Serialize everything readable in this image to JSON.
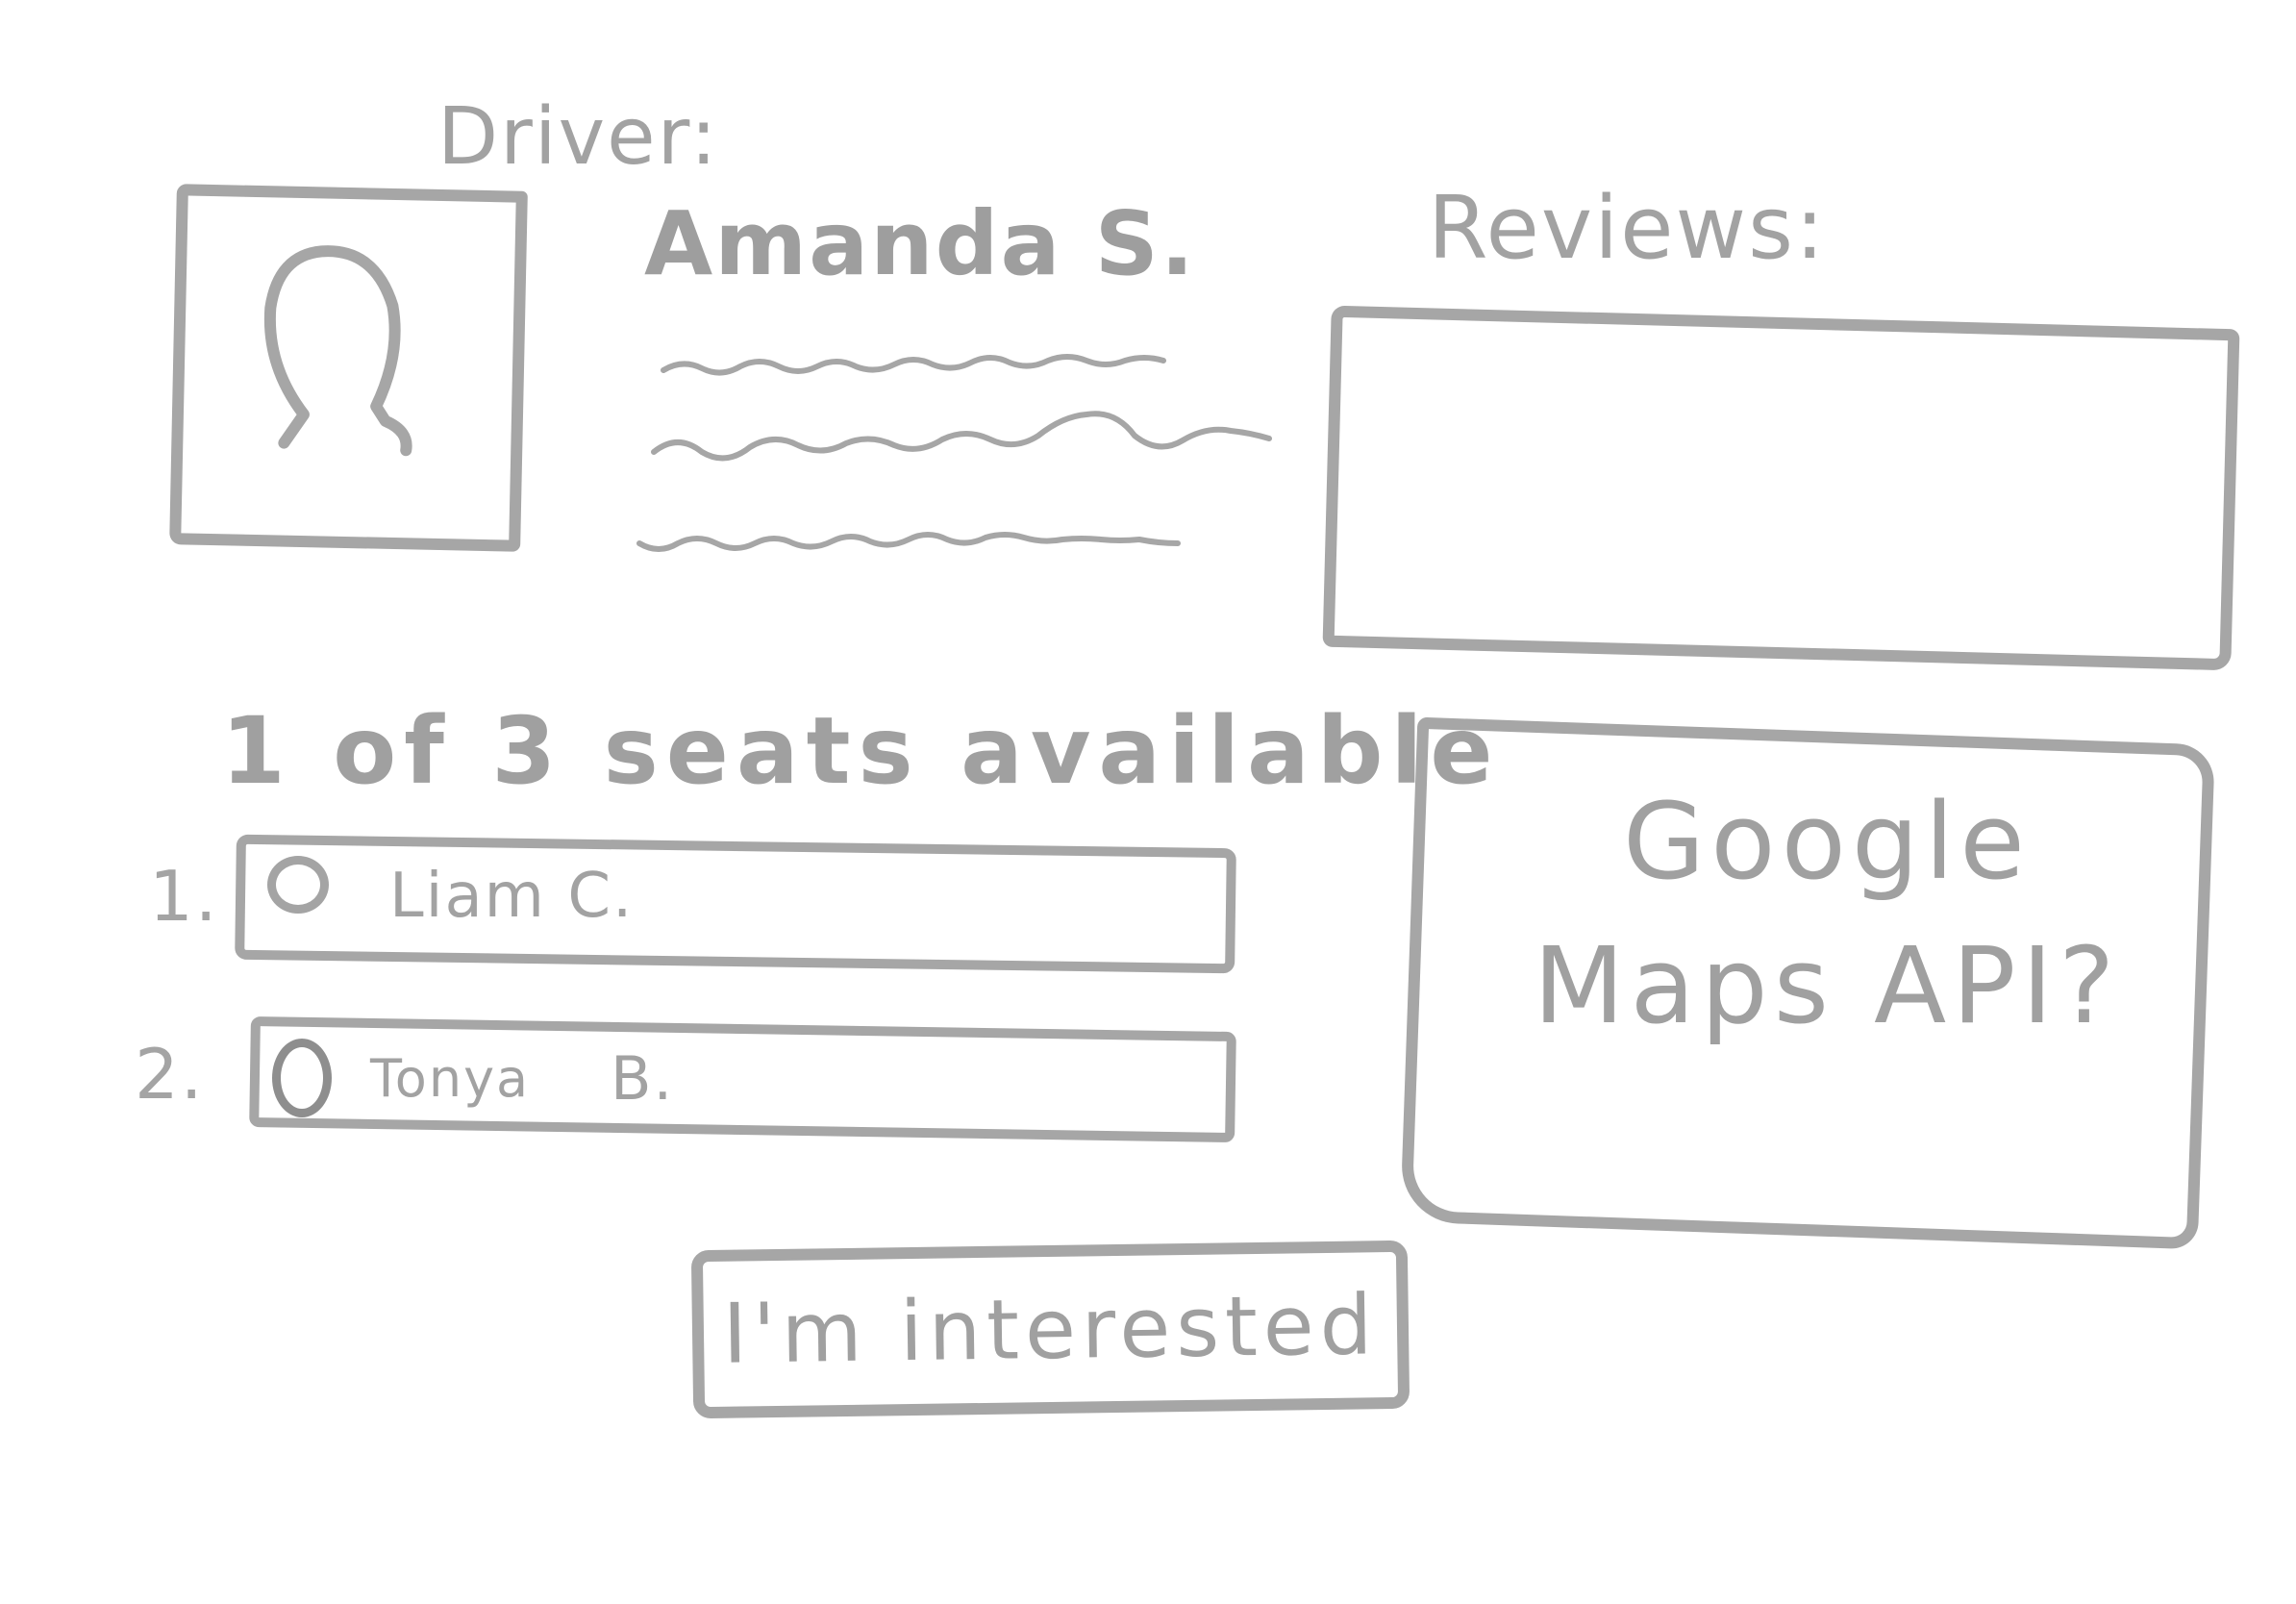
{
  "driver": {
    "label": "Driver:",
    "name": "Amanda S."
  },
  "reviews": {
    "label": "Reviews:"
  },
  "seats": {
    "availability": "1 of 3 seats available",
    "list": [
      {
        "number": "1.",
        "name": "Liam C."
      },
      {
        "number": "2.",
        "name": "Tonya",
        "initial": "B."
      }
    ]
  },
  "map": {
    "line1": "Google",
    "line2": "Maps API?"
  },
  "action": {
    "interest_label": "I'm interested"
  },
  "colors": {
    "stroke": "#a6a6a6",
    "background": "#ffffff"
  },
  "icons": {
    "avatar": "person-silhouette-icon"
  }
}
